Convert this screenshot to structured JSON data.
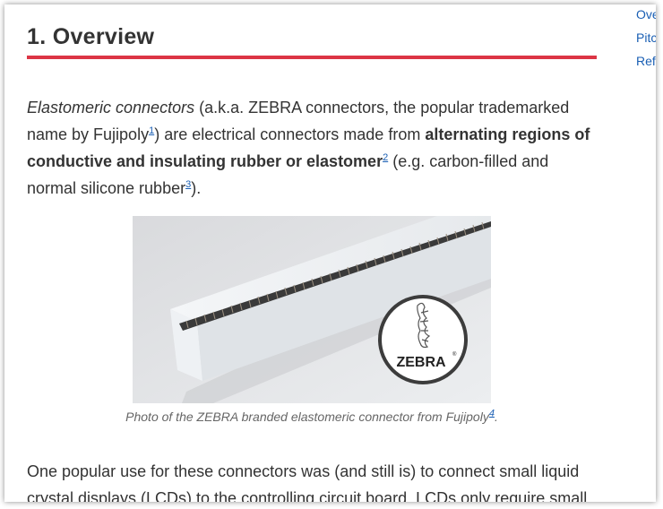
{
  "heading": {
    "number": "1.",
    "title": "Overview"
  },
  "intro": {
    "term": "Elastomeric connectors",
    "text1": " (a.k.a. ZEBRA connectors, the popular trademarked name by Fujipoly",
    "ref1": "1",
    "text2": ") are electrical connectors made from ",
    "bold": "alternating regions of conductive and insulating rubber or elastomer",
    "ref2": "2",
    "text3": " (e.g. carbon-filled and normal silicone rubber",
    "ref3": "3",
    "text4": ")."
  },
  "figure": {
    "logo_text": "ZEBRA",
    "logo_mark": "®",
    "caption": "Photo of the ZEBRA branded elastomeric connector from Fujipoly",
    "caption_ref": "4",
    "caption_end": "."
  },
  "para2": "One popular use for these connectors was (and still is) to connect small liquid crystal displays (LCDs) to the controlling circuit board. LCDs only require small",
  "toc": {
    "items": [
      "Ove",
      "Pitc",
      "Ref"
    ]
  },
  "colors": {
    "accent_rule": "#dc3545",
    "link": "#1a5fb4",
    "text": "#333333"
  }
}
